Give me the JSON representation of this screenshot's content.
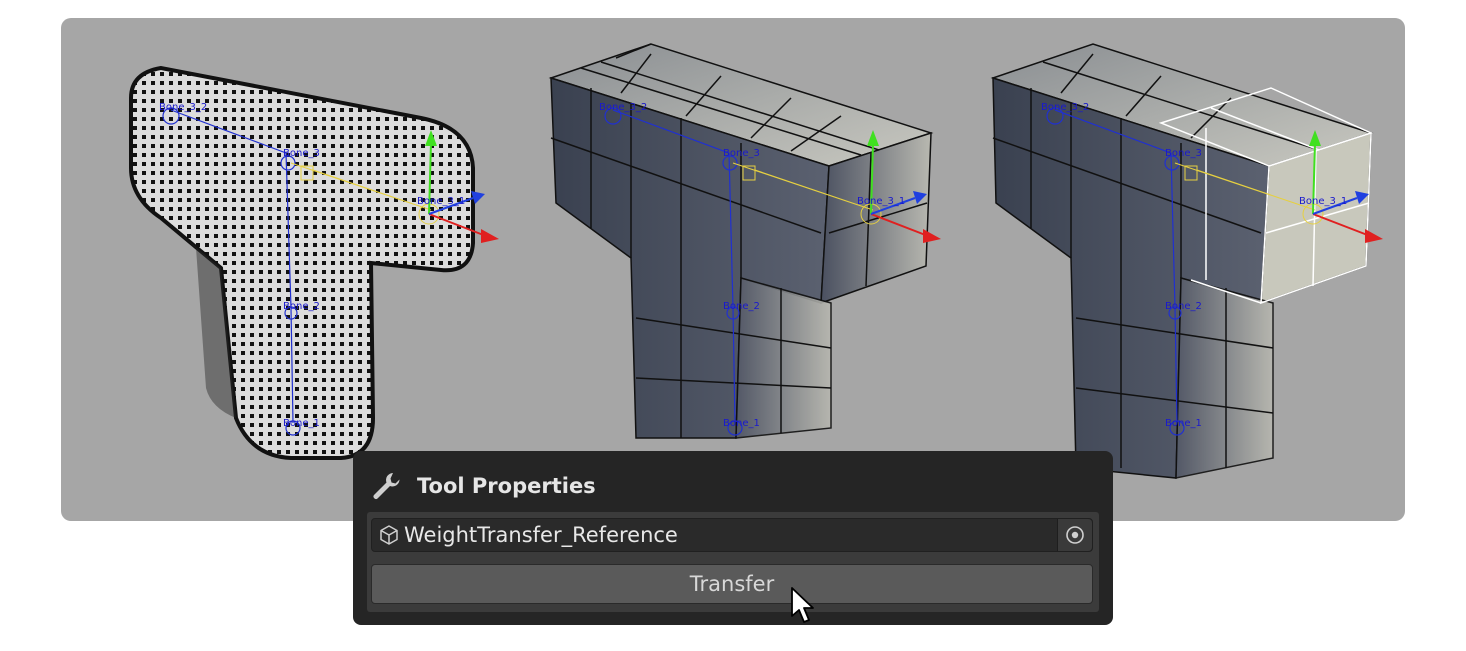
{
  "viewport": {
    "background": "#a6a6a6",
    "models": [
      {
        "name": "dense-mesh",
        "bones": [
          "Bone_3_2",
          "Bone_3",
          "Bone_3_1",
          "Bone_2",
          "Bone_1"
        ]
      },
      {
        "name": "coarse-mesh",
        "bones": [
          "Bone_3_2",
          "Bone_3",
          "Bone_3_1",
          "Bone_2",
          "Bone_1"
        ]
      },
      {
        "name": "coarse-mesh-selected",
        "bones": [
          "Bone_3_2",
          "Bone_3",
          "Bone_3_1",
          "Bone_2",
          "Bone_1"
        ]
      }
    ],
    "gizmo_colors": {
      "x": "#e02020",
      "y": "#40e020",
      "z": "#2040e0"
    }
  },
  "panel": {
    "title": "Tool Properties",
    "title_icon": "wrench-icon",
    "reference_field": {
      "value": "WeightTransfer_Reference",
      "icon": "cube-icon",
      "picker_icon": "object-picker-icon"
    },
    "transfer_button": "Transfer"
  }
}
